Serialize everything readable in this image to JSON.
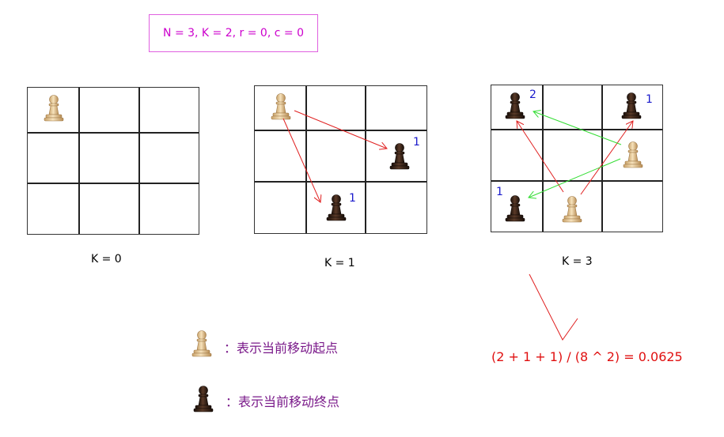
{
  "header": {
    "params": "N = 3, K = 2, r = 0, c = 0"
  },
  "boards": [
    {
      "caption": "K = 0",
      "labels": []
    },
    {
      "caption": "K = 1",
      "labels": [
        "1",
        "1"
      ]
    },
    {
      "caption": "K = 3",
      "labels": [
        "2",
        "1",
        "1"
      ]
    }
  ],
  "legend": {
    "start_text": "：表示当前移动起点",
    "end_text": "：表示当前移动终点"
  },
  "result": {
    "formula": "(2 + 1 + 1) / (8 ^ 2) = 0.0625"
  },
  "colors": {
    "param_border": "#e060e0",
    "param_text": "#cc00cc",
    "arrow_red": "#e02020",
    "arrow_green": "#33dd33",
    "label_blue": "#1a1acc",
    "light_piece": "#e8c896",
    "dark_piece": "#3a2418"
  },
  "icons": {
    "start": "light-pawn-icon",
    "end": "dark-pawn-icon"
  }
}
